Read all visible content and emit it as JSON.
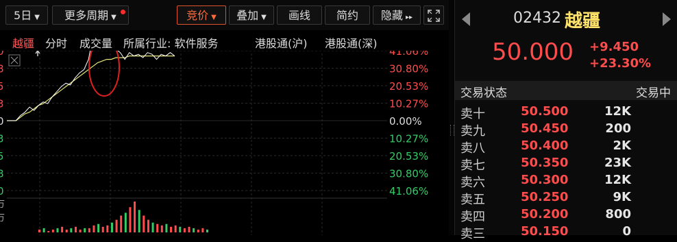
{
  "toolbar": {
    "period": "5日",
    "more_period": "更多周期",
    "bid": "竞价",
    "overlay": "叠加",
    "draw": "画线",
    "brief": "简约",
    "hide": "隐藏"
  },
  "infobar": {
    "stock_name": "越疆",
    "time_share": "分时",
    "volume": "成交量",
    "industry": "所属行业: 软件服务",
    "hk_connect_sh": "港股通(沪)",
    "hk_connect_sz": "港股通(深)"
  },
  "axis": {
    "right_up": [
      "41.06%",
      "30.80%",
      "20.53%",
      "10.27%"
    ],
    "zero": "0.00%",
    "right_down": [
      "10.27%",
      "20.53%",
      "30.80%",
      "41.06%"
    ],
    "left_digits": [
      "0",
      "8",
      "5",
      "3",
      "0",
      "3",
      "5",
      "8",
      "0"
    ],
    "left_vol": [
      "万",
      "万"
    ]
  },
  "chart_data": {
    "type": "line",
    "series": [
      {
        "values": [
          0,
          0,
          0,
          0.3,
          0.5,
          0.8,
          0.6,
          0.9,
          1.1,
          1.0,
          1.4,
          1.7,
          2.0,
          2.2,
          2.1,
          2.5,
          2.8,
          3.0,
          3.6,
          5.0,
          7.6,
          8.5,
          6.0,
          4.5,
          4.2,
          4.0,
          3.6,
          4.0,
          3.8,
          3.9,
          3.7,
          4.0,
          3.9,
          3.6,
          3.9,
          3.8,
          4.0,
          3.8
        ]
      },
      {
        "values": [
          0,
          0,
          0,
          0.2,
          0.4,
          0.5,
          0.7,
          0.9,
          1.0,
          1.2,
          1.4,
          1.6,
          1.8,
          2.0,
          2.2,
          2.4,
          2.6,
          2.8,
          3.0,
          3.2,
          3.4,
          3.5,
          3.6,
          3.6,
          3.7,
          3.7,
          3.7,
          3.8,
          3.8,
          3.8,
          3.8,
          3.8,
          3.8,
          3.8,
          3.8,
          3.8,
          3.8,
          3.8
        ]
      }
    ],
    "volume": [
      2,
      3,
      1,
      2,
      3,
      4,
      2,
      3,
      4,
      2,
      3,
      3,
      5,
      6,
      4,
      5,
      7,
      9,
      12,
      14,
      18,
      22,
      16,
      12,
      9,
      7,
      6,
      5,
      6,
      4,
      5,
      4,
      3,
      4,
      3,
      2,
      3,
      2
    ],
    "colors": {
      "price": "#ffffff",
      "avg": "#e6e67a",
      "vol_up": "#ff4c4c",
      "vol_down": "#33cc66"
    },
    "annotation": "red ellipse around spike"
  },
  "quote": {
    "code": "02432",
    "name": "越疆",
    "price": "50.000",
    "change": "+9.450",
    "change_pct": "+23.30%",
    "status_label": "交易状态",
    "status_value": "交易中"
  },
  "orders": [
    {
      "label": "卖十",
      "price": "50.500",
      "vol": "12K"
    },
    {
      "label": "卖九",
      "price": "50.450",
      "vol": "200"
    },
    {
      "label": "卖八",
      "price": "50.400",
      "vol": "2K"
    },
    {
      "label": "卖七",
      "price": "50.350",
      "vol": "23K"
    },
    {
      "label": "卖六",
      "price": "50.300",
      "vol": "12K"
    },
    {
      "label": "卖五",
      "price": "50.250",
      "vol": "9K"
    },
    {
      "label": "卖四",
      "price": "50.200",
      "vol": "800"
    },
    {
      "label": "卖三",
      "price": "50.150",
      "vol": "0"
    }
  ]
}
